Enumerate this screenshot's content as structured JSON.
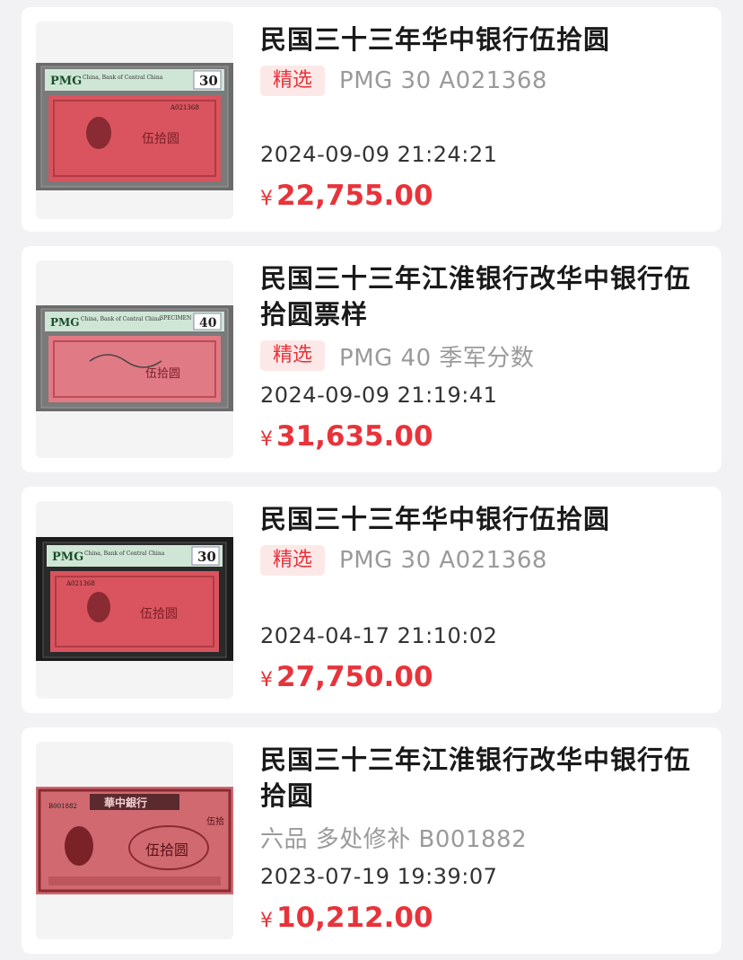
{
  "currency_symbol": "¥",
  "colors": {
    "accent": "#e8333a",
    "tag_bg": "#fde8e8",
    "banknote": "#d9545e",
    "slab_label": "#cfe6d6"
  },
  "items": [
    {
      "title": "民国三十三年华中银行伍拾圆",
      "tag": "精选",
      "subtitle": "PMG 30 A021368",
      "date": "2024-09-09 21:24:21",
      "price": "22,755.00",
      "image": {
        "pmg_logo": "PMG",
        "grade": "30",
        "label_text": "China, Bank of Central China",
        "note_text": "伍拾圆",
        "serial": "A021368"
      }
    },
    {
      "title": "民国三十三年江淮银行改华中银行伍拾圆票样",
      "tag": "精选",
      "subtitle": "PMG 40 季军分数",
      "date": "2024-09-09 21:19:41",
      "price": "31,635.00",
      "image": {
        "pmg_logo": "PMG",
        "grade": "40",
        "label_text": "China, Bank of Central China",
        "specimen": "SPECIMEN",
        "note_text": "伍拾圆"
      }
    },
    {
      "title": "民国三十三年华中银行伍拾圆",
      "tag": "精选",
      "subtitle": "PMG 30 A021368",
      "date": "2024-04-17 21:10:02",
      "price": "27,750.00",
      "image": {
        "pmg_logo": "PMG",
        "grade": "30",
        "label_text": "China, Bank of Central China",
        "note_text": "伍拾圆",
        "serial": "A021368"
      }
    },
    {
      "title": "民国三十三年江淮银行改华中银行伍拾圆",
      "tag": "",
      "subtitle": "六品 多处修补 B001882",
      "date": "2023-07-19 19:39:07",
      "price": "10,212.00",
      "image": {
        "note_text": "伍拾圆",
        "bank_text": "華中銀行",
        "serial": "B001882",
        "corner_text": "伍拾"
      }
    }
  ]
}
